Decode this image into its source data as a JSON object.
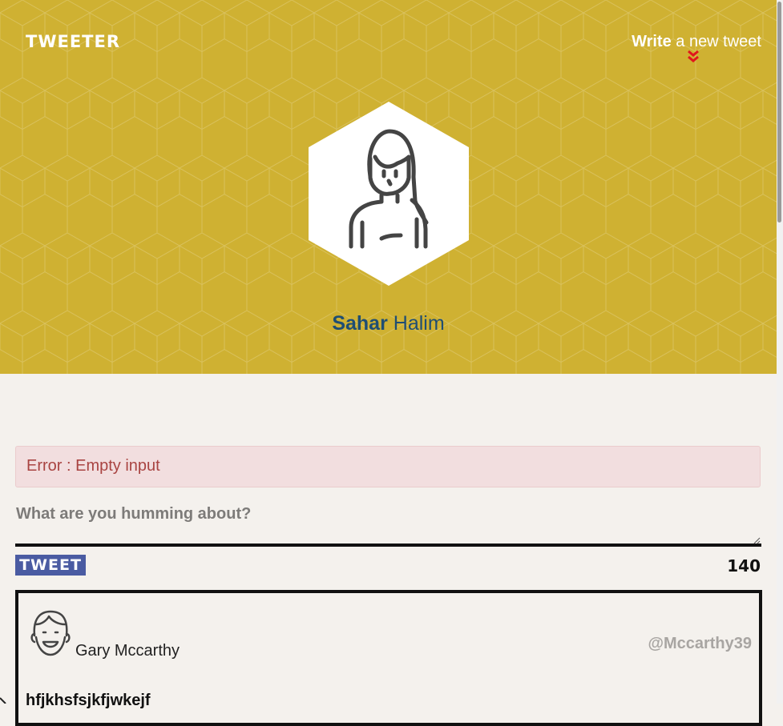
{
  "nav": {
    "logo": "TWEETER",
    "write_bold": "Write",
    "write_rest": " a new tweet"
  },
  "profile": {
    "first_name": "Sahar",
    "last_name": "Halim"
  },
  "error": {
    "message": "Error : Empty input"
  },
  "composer": {
    "placeholder": "What are you humming about?",
    "value": "",
    "button_label": "TWEET",
    "counter": "140"
  },
  "tweets": [
    {
      "author": "Gary Mccarthy",
      "handle": "@Mccarthy39",
      "text": "hfjkhsfsjkfjwkejf"
    }
  ],
  "colors": {
    "header_bg": "#cfb132",
    "name_color": "#1f4e73",
    "button_bg": "#4a5ba2",
    "error_bg": "#f2dedf",
    "error_text": "#a94442",
    "chevron": "#e0161c"
  },
  "icons": {
    "profile_avatar": "woman-avatar-icon",
    "write_chevron": "double-chevron-down-icon",
    "tweet_avatar": "smiling-man-avatar-icon"
  }
}
